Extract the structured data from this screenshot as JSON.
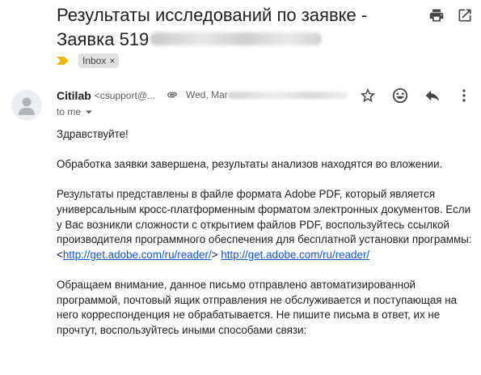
{
  "subject": {
    "line1": "Результаты исследований по заявке -",
    "line2_prefix": "Заявка 519"
  },
  "label": {
    "name": "Inbox",
    "remove": "×"
  },
  "sender": {
    "name": "Citilab",
    "email": "<csupport@...",
    "to": "to me"
  },
  "date": {
    "prefix": "Wed, Mar"
  },
  "body": {
    "greeting": "Здравствуйте!",
    "p1": "Обработка заявки завершена, результаты анализов находятся во вложении.",
    "p2": "Результаты представлены в файле формата Adobe PDF, который является универсальным кросс-платформенным форматом электронных документов. Если у Вас возникли сложности с открытием файлов PDF, воспользуйтесь ссылкой производителя программного обеспечения для бесплатной установки программы:",
    "link_bracket_open": "<",
    "link1": "http://get.adobe.com/ru/reader/",
    "link_bracket_close": ">",
    "link2": "http://get.adobe.com/ru/reader/",
    "p3": "Обращаем внимание, данное письмо отправлено автоматизированной программой, почтовый ящик отправления не обслуживается и поступающая на него корреспонденция не обрабатывается. Не пишите письма в ответ, их не прочтут, воспользуйтесь иными способами связи:"
  },
  "icons": {
    "print": "print-icon",
    "open_new": "open-in-new-window-icon",
    "importance": "importance-marker-icon",
    "attachment": "attachment-icon",
    "star": "star-icon",
    "emoji": "emoji-reaction-icon",
    "reply": "reply-icon",
    "more": "more-options-icon",
    "avatar": "avatar-person-icon",
    "caret": "caret-down-icon"
  },
  "colors": {
    "link": "#1155cc",
    "importance": "#f2b600",
    "chip_bg": "#e0e0e0"
  }
}
